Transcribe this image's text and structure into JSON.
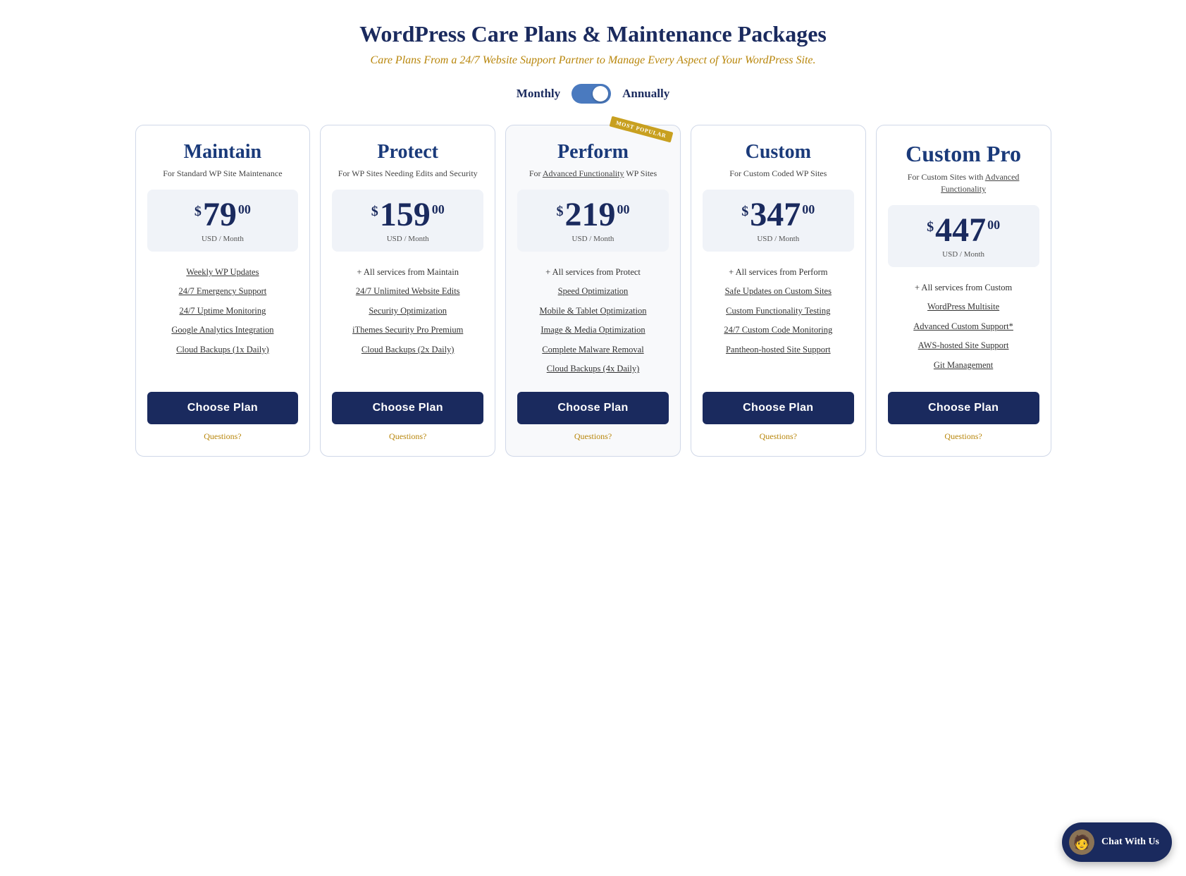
{
  "header": {
    "title": "WordPress Care Plans & Maintenance Packages",
    "subtitle": "Care Plans From a 24/7 Website Support Partner to Manage Every Aspect of Your WordPress Site."
  },
  "billing": {
    "monthly_label": "Monthly",
    "annually_label": "Annually",
    "toggle_state": "annually"
  },
  "plans": [
    {
      "id": "maintain",
      "name": "Maintain",
      "description": "For Standard WP Site Maintenance",
      "price_dollar": "$",
      "price_main": "79",
      "price_cents": "00",
      "price_period": "USD / Month",
      "featured": false,
      "most_popular": false,
      "features": [
        "Weekly WP Updates",
        "24/7 Emergency Support",
        "24/7 Uptime Monitoring",
        "Google Analytics Integration",
        "Cloud Backups (1x Daily)"
      ],
      "choose_label": "Choose Plan",
      "questions_label": "Questions?"
    },
    {
      "id": "protect",
      "name": "Protect",
      "description": "For WP Sites Needing Edits and Security",
      "price_dollar": "$",
      "price_main": "159",
      "price_cents": "00",
      "price_period": "USD / Month",
      "featured": false,
      "most_popular": false,
      "features": [
        "+ All services from Maintain",
        "24/7 Unlimited Website Edits",
        "Security Optimization",
        "iThemes Security Pro Premium",
        "Cloud Backups (2x Daily)"
      ],
      "choose_label": "Choose Plan",
      "questions_label": "Questions?"
    },
    {
      "id": "perform",
      "name": "Perform",
      "description": "For Advanced Functionality WP Sites",
      "price_dollar": "$",
      "price_main": "219",
      "price_cents": "00",
      "price_period": "USD / Month",
      "featured": true,
      "most_popular": true,
      "most_popular_badge": "MOST POPULAR",
      "features": [
        "+ All services from Protect",
        "Speed Optimization",
        "Mobile & Tablet Optimization",
        "Image & Media Optimization",
        "Complete Malware Removal",
        "Cloud Backups (4x Daily)"
      ],
      "choose_label": "Choose Plan",
      "questions_label": "Questions?"
    },
    {
      "id": "custom",
      "name": "Custom",
      "description": "For Custom Coded WP Sites",
      "price_dollar": "$",
      "price_main": "347",
      "price_cents": "00",
      "price_period": "USD / Month",
      "featured": false,
      "most_popular": false,
      "features": [
        "+ All services from Perform",
        "Safe Updates on Custom Sites",
        "Custom Functionality Testing",
        "24/7 Custom Code Monitoring",
        "Pantheon-hosted Site Support"
      ],
      "choose_label": "Choose Plan",
      "questions_label": "Questions?"
    },
    {
      "id": "custom-pro",
      "name": "Custom Pro",
      "description": "For Custom Sites with Advanced Functionality",
      "price_dollar": "$",
      "price_main": "447",
      "price_cents": "00",
      "price_period": "USD / Month",
      "featured": false,
      "most_popular": false,
      "features": [
        "+ All services from Custom",
        "WordPress Multisite",
        "Advanced Custom Support*",
        "AWS-hosted Site Support",
        "Git Management"
      ],
      "choose_label": "Choose Plan",
      "questions_label": "Questions?"
    }
  ],
  "chat_widget": {
    "label": "Chat With Us"
  }
}
